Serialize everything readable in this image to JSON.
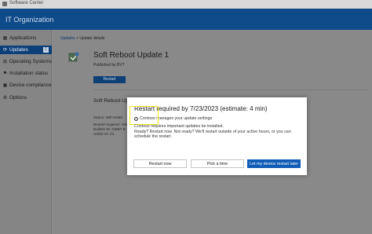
{
  "window": {
    "title": "Software Center"
  },
  "header": {
    "org_name": "IT Organization"
  },
  "sidebar": {
    "items": [
      {
        "label": "Applications",
        "icon": "grid-icon"
      },
      {
        "label": "Updates",
        "icon": "refresh-icon",
        "badge": "1"
      },
      {
        "label": "Operating Systems",
        "icon": "windows-icon"
      },
      {
        "label": "Installation status",
        "icon": "flag-icon"
      },
      {
        "label": "Device compliance",
        "icon": "device-icon"
      },
      {
        "label": "Options",
        "icon": "gear-icon"
      }
    ]
  },
  "breadcrumb": {
    "root": "Updates",
    "separator": ">",
    "current": "Update details"
  },
  "update": {
    "title": "Soft Reboot Update 1",
    "publisher": "Published by BVT",
    "restart_label": "Restart",
    "section_title": "Soft Reboot Update",
    "details": [
      "Status: Will restart ",
      "Restart required: Yes",
      "Bulletin ID: CMBT B",
      "Article ID: 21"
    ]
  },
  "modal": {
    "title": "Restart required by 7/23/2023 (estimate: 4 min)",
    "managed_by": "Contoso manages your update settings",
    "body_line1": "Contoso requires important updates be installed.",
    "body_line2": "Ready? Restart now. Not ready? We'll restart outside of your active hours, or you can schedule the restart.",
    "buttons": {
      "restart_now": "Restart now",
      "pick_time": "Pick a time",
      "let_device_restart": "Let my device restart later"
    }
  }
}
